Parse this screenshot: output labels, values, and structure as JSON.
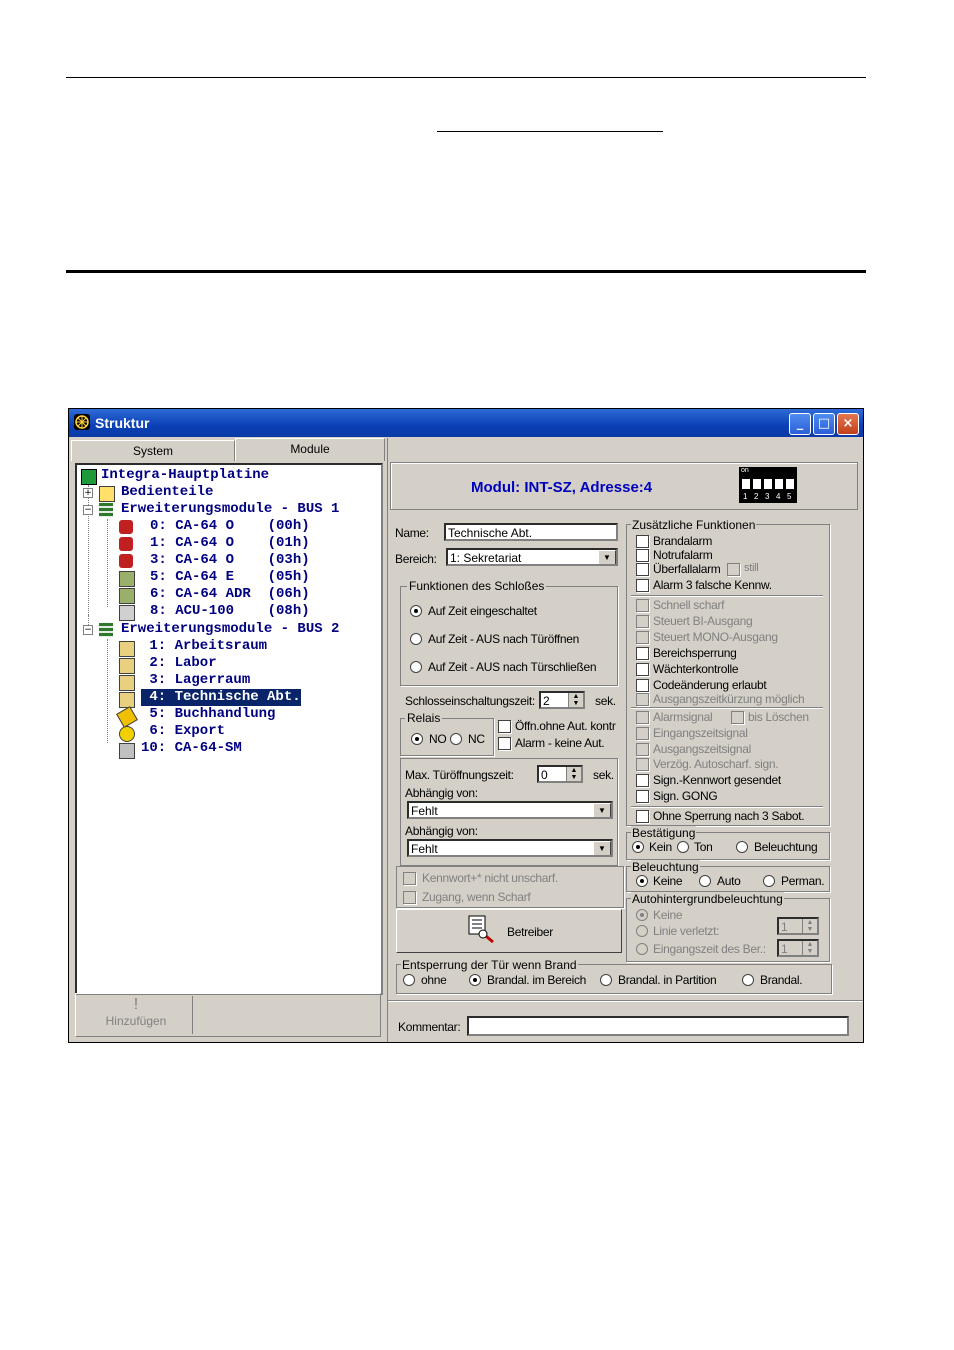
{
  "window": {
    "title": "Struktur",
    "minimize": "_",
    "maximize": "□",
    "close": "×"
  },
  "left_tabs": [
    "System",
    "Module"
  ],
  "tree": {
    "root": "Integra-Hauptplatine",
    "bedienteile": "Bedienteile",
    "bus1": "Erweiterungsmodule - BUS 1",
    "bus1_items": [
      "0: CA-64 O    (00h)",
      "1: CA-64 O    (01h)",
      "3: CA-64 O    (03h)",
      "5: CA-64 E    (05h)",
      "6: CA-64 ADR  (06h)",
      "8: ACU-100    (08h)"
    ],
    "bus2": "Erweiterungsmodule - BUS 2",
    "bus2_items": [
      " 1: Arbeitsraum",
      " 2: Labor",
      " 3: Lagerraum",
      " 4: Technische Abt.",
      " 5: Buchhandlung",
      " 6: Export",
      "10: CA-64-SM"
    ]
  },
  "add_button": "Hinzufügen",
  "header": {
    "module_title": "Modul: INT-SZ, Adresse:4",
    "dip_label": "on",
    "dip_numbers": [
      "1",
      "2",
      "3",
      "4",
      "5"
    ]
  },
  "form": {
    "name_label": "Name:",
    "name_value": "Technische Abt.",
    "bereich_label": "Bereich:",
    "bereich_value": "1: Sekretariat",
    "lock_group": "Funktionen des Schloßes",
    "lock_options": [
      "Auf Zeit eingeschaltet",
      "Auf Zeit - AUS nach Türöffnen",
      "Auf Zeit - AUS nach Türschließen"
    ],
    "lock_time_label": "Schlosseinschaltungszeit:",
    "lock_time_value": "2",
    "sek": "sek.",
    "relais_group": "Relais",
    "relais_no": "NO",
    "relais_nc": "NC",
    "oeffn": "Öffn.ohne Aut. kontr",
    "alarm_keine": "Alarm - keine Aut.",
    "max_open_label": "Max. Türöffnungszeit:",
    "max_open_value": "0",
    "abh1_label": "Abhängig von:",
    "abh1_value": "Fehlt",
    "abh2_label": "Abhängig von:",
    "abh2_value": "Fehlt",
    "kennwort": "Kennwort+* nicht unscharf.",
    "zugang": "Zugang, wenn Scharf",
    "betreiber": "Betreiber",
    "entsperrung_group": "Entsperrung der Tür wenn Brand",
    "entsperrung_options": [
      "ohne",
      "Brandal. im Bereich",
      "Brandal. in Partition",
      "Brandal."
    ],
    "kommentar_label": "Kommentar:",
    "kommentar_value": ""
  },
  "extra": {
    "group": "Zusätzliche Funktionen",
    "items_a": [
      "Brandalarm",
      "Notrufalarm",
      "Überfallalarm"
    ],
    "still": "still",
    "alarm3": "Alarm 3 falsche Kennw.",
    "items_b_disabled": [
      "Schnell scharf",
      "Steuert BI-Ausgang",
      "Steuert MONO-Ausgang"
    ],
    "items_c": [
      "Bereichsperrung",
      "Wächterkontrolle",
      "Codeänderung erlaubt"
    ],
    "ausgang_kurz": "Ausgangszeitkürzung möglich",
    "alarmsignal": "Alarmsignal",
    "bis_loeschen": "bis Löschen",
    "items_d_disabled": [
      "Eingangszeitsignal",
      "Ausgangszeitsignal",
      "Verzög. Autoscharf. sign."
    ],
    "items_e": [
      "Sign.-Kennwort gesendet",
      "Sign. GONG"
    ],
    "ohne_sperrung": "Ohne Sperrung nach 3 Sabot."
  },
  "bestaetigung": {
    "group": "Bestätigung",
    "options": [
      "Kein",
      "Ton",
      "Beleuchtung"
    ]
  },
  "beleuchtung": {
    "group": "Beleuchtung",
    "options": [
      "Keine",
      "Auto",
      "Perman."
    ]
  },
  "autohintergrund": {
    "group": "Autohintergrundbeleuchtung",
    "options": [
      "Keine",
      "Linie verletzt:",
      "Eingangszeit des Ber.:"
    ],
    "value1": "1",
    "value2": "1"
  },
  "colors": {
    "title_blue": "#0a3fb5",
    "module_title": "#0000c0",
    "tree_text": "#000080",
    "selection": "#0a246a"
  }
}
